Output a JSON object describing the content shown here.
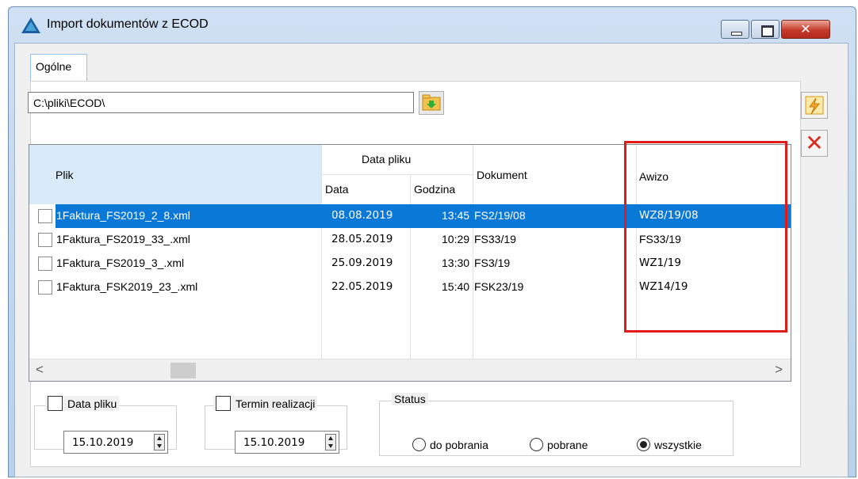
{
  "window": {
    "title": "Import dokumentów z ECOD",
    "close_symbol": "✕"
  },
  "tabs": [
    {
      "label": "Ogólne",
      "active": true
    }
  ],
  "path": {
    "value": "C:\\pliki\\ECOD\\"
  },
  "grid": {
    "header": {
      "plik": "Plik",
      "data_pliku": "Data pliku",
      "data": "Data",
      "godzina": "Godzina",
      "dokument": "Dokument",
      "awizo": "Awizo"
    },
    "rows": [
      {
        "plik": "1Faktura_FS2019_2_8.xml",
        "data": "08.08.2019",
        "godzina": "13:45",
        "dokument": "FS2/19/08",
        "awizo": "WZ8/19/08",
        "selected": true
      },
      {
        "plik": "1Faktura_FS2019_33_.xml",
        "data": "28.05.2019",
        "godzina": "10:29",
        "dokument": "FS33/19",
        "awizo": "FS33/19",
        "selected": false
      },
      {
        "plik": "1Faktura_FS2019_3_.xml",
        "data": "25.09.2019",
        "godzina": "13:30",
        "dokument": "FS3/19",
        "awizo": "WZ1/19",
        "selected": false
      },
      {
        "plik": "1Faktura_FSK2019_23_.xml",
        "data": "22.05.2019",
        "godzina": "15:40",
        "dokument": "FSK23/19",
        "awizo": "WZ14/19",
        "selected": false
      }
    ],
    "scroll_left": "<",
    "scroll_right": ">"
  },
  "filters": {
    "data_pliku": {
      "label": "Data pliku",
      "checked": false,
      "value": "15.10.2019"
    },
    "termin": {
      "label": "Termin realizacji",
      "checked": false,
      "value": "15.10.2019"
    },
    "status": {
      "label": "Status",
      "options": [
        "do pobrania",
        "pobrane",
        "wszystkie"
      ],
      "selected": "wszystkie"
    }
  },
  "side_buttons": {
    "delete_symbol": "✕"
  },
  "colors": {
    "selection": "#0a78d7",
    "highlight": "#e21a1a",
    "header_bg": "#d9eaf8"
  }
}
